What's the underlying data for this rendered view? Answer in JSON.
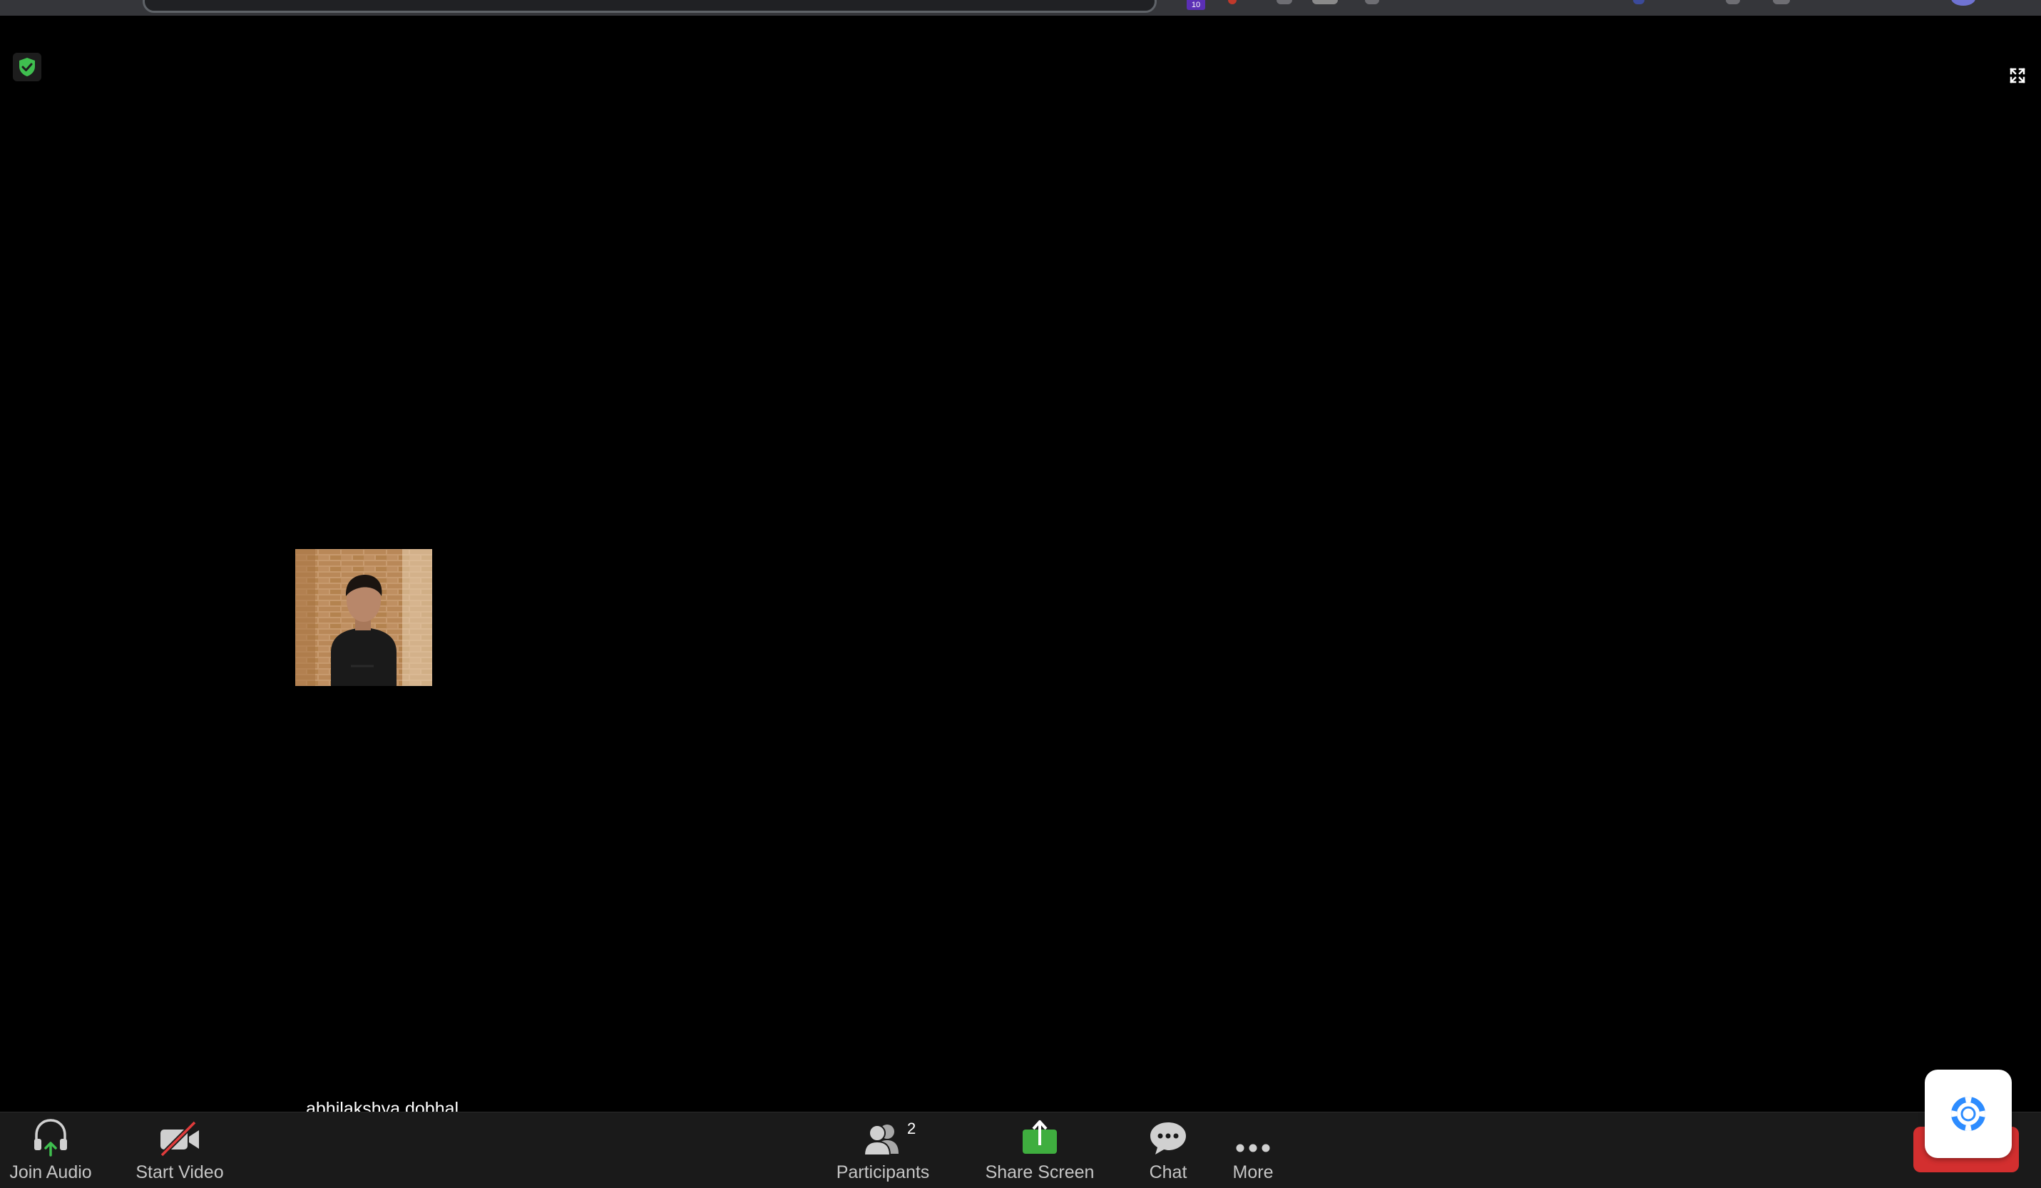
{
  "browser": {
    "extension_badge": "10"
  },
  "meeting": {
    "participant_name": "abhilakshya dobhal",
    "security_icon": "shield-check-icon",
    "fullscreen_icon": "fullscreen-icon"
  },
  "toolbar": {
    "join_audio": "Join Audio",
    "start_video": "Start Video",
    "participants": "Participants",
    "participants_count": "2",
    "share_screen": "Share Screen",
    "chat": "Chat",
    "more": "More"
  },
  "help": {
    "icon": "lifebuoy-icon"
  },
  "colors": {
    "background": "#000000",
    "toolbar": "#1a1a1a",
    "share_green": "#3fae3f",
    "end_red": "#d32f2f",
    "help_blue": "#2d8cff"
  }
}
